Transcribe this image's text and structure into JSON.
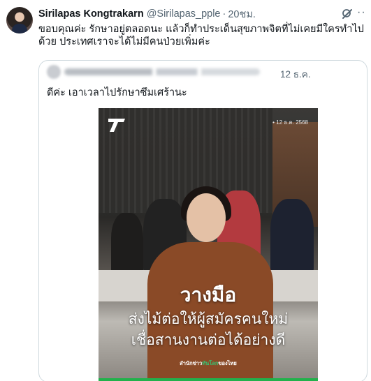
{
  "tweet": {
    "author_name": "Sirilapas Kongtrakarn",
    "handle": "@Sirilapas_pple",
    "separator": "·",
    "time": "20ชม.",
    "more_label": "··",
    "text": "ขอบคุณค่ะ รักษาอยู่ตลอดนะ แล้วก็ทำประเด็นสุขภาพจิตที่ไม่เคยมีใครทำไปด้วย ประเทศเราจะได้ไม่มีคนป่วยเพิ่มค่ะ"
  },
  "quote": {
    "date": "12 ธ.ค.",
    "text": "ดีค่ะ เอาเวลาไปรักษาซึมเศร้านะ",
    "media": {
      "date_stamp": "• 12 ธ.ค. 2568",
      "headline": "วางมือ",
      "subline_1": "ส่งไม้ต่อให้ผู้สมัครคนใหม่",
      "subline_2": "เชื่อสานงานต่อได้อย่างดี",
      "footer_prefix": "สำนักข่าว",
      "footer_accent": "ทันโลก",
      "footer_suffix": "ของไทย"
    }
  },
  "colors": {
    "accent_green": "#22b14c",
    "muted_text": "#536471",
    "border": "#cfd9de"
  },
  "icons": {
    "grok": "grok-icon",
    "more": "more-icon",
    "logo": "news-logo-icon"
  }
}
